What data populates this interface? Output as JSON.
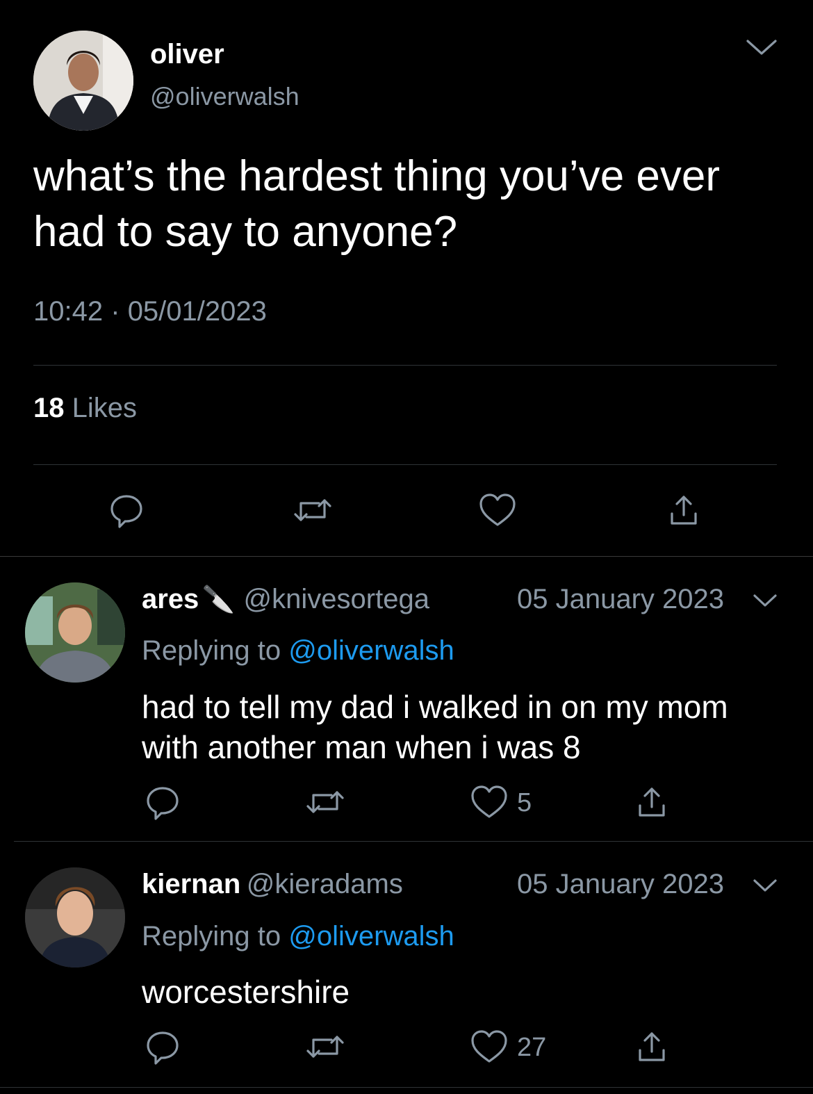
{
  "main_tweet": {
    "display_name": "oliver",
    "handle": "@oliverwalsh",
    "text": "what’s the hardest thing you’ve ever had to say to anyone?",
    "time": "10:42",
    "separator": "·",
    "date": "05/01/2023",
    "likes_count": "18",
    "likes_label": "Likes",
    "icons": [
      "chevron-down-icon",
      "reply-icon",
      "retweet-icon",
      "heart-icon",
      "share-icon"
    ]
  },
  "replies": [
    {
      "display_name": "ares",
      "name_emoji": "🔪",
      "handle": "@knivesortega",
      "date": "05 January 2023",
      "replying_prefix": "Replying to",
      "replying_to": "@oliverwalsh",
      "text": "had to tell my dad i walked in on my mom with another man when i was 8",
      "like_count": "5"
    },
    {
      "display_name": "kiernan",
      "handle": "@kieradams",
      "date": "05 January 2023",
      "replying_prefix": "Replying to",
      "replying_to": "@oliverwalsh",
      "text": "worcestershire",
      "like_count": "27"
    }
  ],
  "colors": {
    "background": "#000000",
    "secondary_text": "#8b98a5",
    "mention": "#1d9bf0",
    "divider": "#2f3336"
  }
}
